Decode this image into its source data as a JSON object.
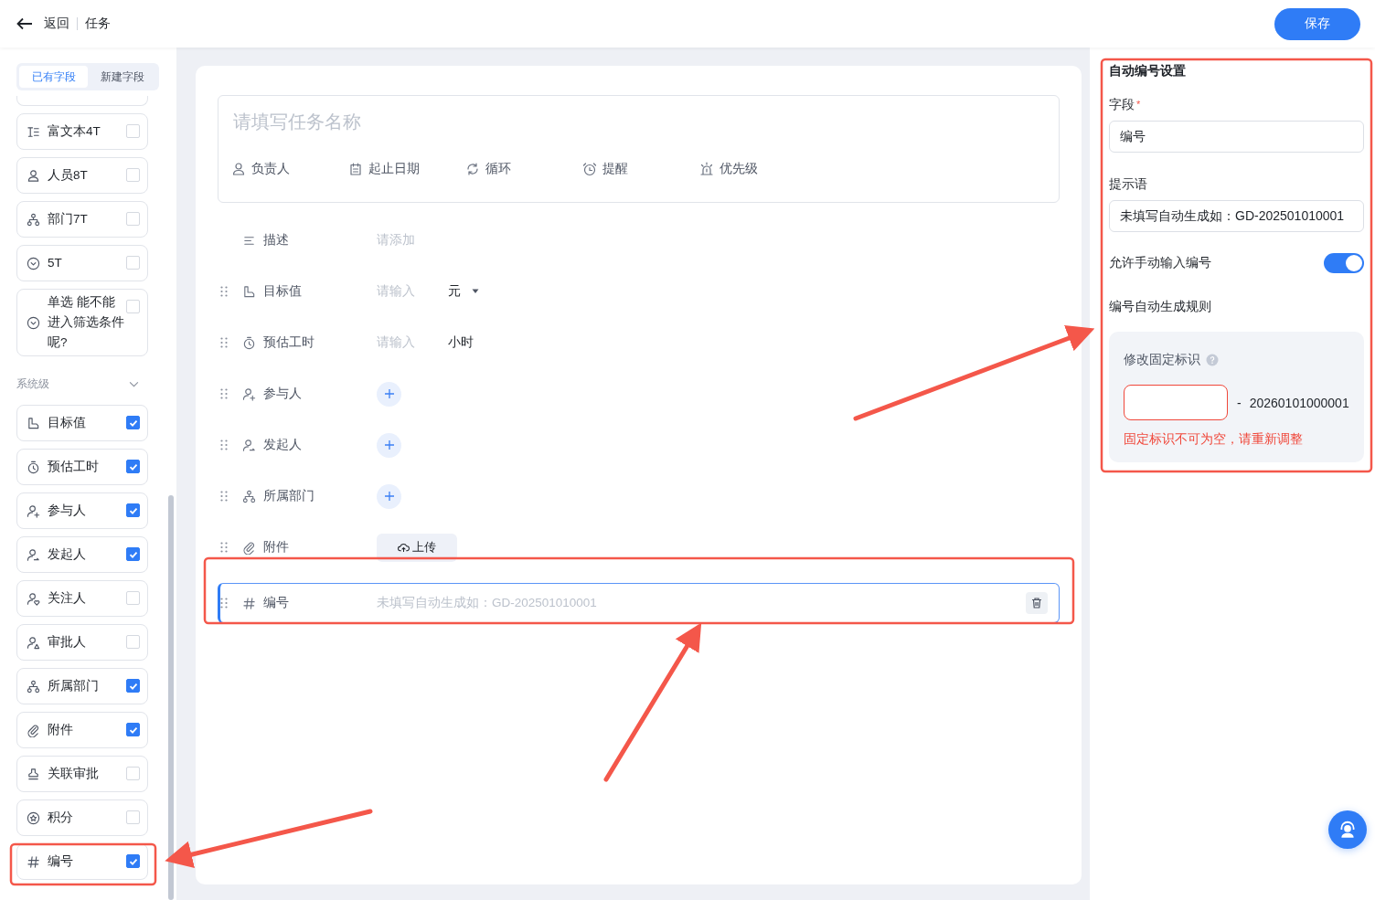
{
  "header": {
    "back_label": "返回",
    "title": "任务",
    "save_label": "保存"
  },
  "sidebar": {
    "tabs": [
      {
        "label": "已有字段",
        "selected": true
      },
      {
        "label": "新建字段",
        "selected": false
      }
    ],
    "custom_fields": [
      {
        "label": "富文本4T",
        "kind": "text",
        "checked": false
      },
      {
        "label": "人员8T",
        "kind": "person",
        "checked": false
      },
      {
        "label": "部门7T",
        "kind": "org",
        "checked": false
      },
      {
        "label": "5T",
        "kind": "select",
        "checked": false
      },
      {
        "label": "单选 能不能进入筛选条件呢?",
        "kind": "select",
        "checked": false
      }
    ],
    "group": {
      "label": "系统级",
      "expanded": true
    },
    "system_fields": [
      {
        "label": "目标值",
        "kind": "target",
        "checked": true
      },
      {
        "label": "预估工时",
        "kind": "timer",
        "checked": true
      },
      {
        "label": "参与人",
        "kind": "person-add",
        "checked": true
      },
      {
        "label": "发起人",
        "kind": "person-send",
        "checked": true
      },
      {
        "label": "关注人",
        "kind": "person-heart",
        "checked": false
      },
      {
        "label": "审批人",
        "kind": "person-stamp",
        "checked": false
      },
      {
        "label": "所属部门",
        "kind": "org",
        "checked": true
      },
      {
        "label": "附件",
        "kind": "clip",
        "checked": true
      },
      {
        "label": "关联审批",
        "kind": "stamp",
        "checked": false
      },
      {
        "label": "积分",
        "kind": "star",
        "checked": false
      },
      {
        "label": "编号",
        "kind": "hash",
        "checked": true
      }
    ]
  },
  "form": {
    "title_placeholder": "请填写任务名称",
    "quick_fields": [
      {
        "label": "负责人",
        "kind": "person"
      },
      {
        "label": "起止日期",
        "kind": "calendar"
      },
      {
        "label": "循环",
        "kind": "repeat"
      },
      {
        "label": "提醒",
        "kind": "alarm"
      },
      {
        "label": "优先级",
        "kind": "beacon"
      }
    ],
    "rows": [
      {
        "label": "描述",
        "kind": "description",
        "selected": false,
        "placeholder": "请添加"
      },
      {
        "label": "目标值",
        "kind": "target",
        "selected": false,
        "placeholder": "请输入",
        "unit": "元",
        "unit_dropdown": true
      },
      {
        "label": "预估工时",
        "kind": "timer",
        "selected": false,
        "placeholder": "请输入",
        "unit": "小时",
        "unit_dropdown": false
      },
      {
        "label": "参与人",
        "kind": "person-add",
        "selected": false
      },
      {
        "label": "发起人",
        "kind": "person-send",
        "selected": false
      },
      {
        "label": "所属部门",
        "kind": "org",
        "selected": false
      },
      {
        "label": "附件",
        "kind": "clip",
        "selected": false,
        "button_label": "上传"
      },
      {
        "label": "编号",
        "kind": "hash",
        "selected": true,
        "placeholder": "未填写自动生成如：GD-202501010001"
      }
    ]
  },
  "settings": {
    "title": "自动编号设置",
    "field": {
      "label": "字段",
      "required_mark": "*",
      "value": "编号"
    },
    "hint": {
      "label": "提示语",
      "value": "未填写自动生成如：GD-202501010001"
    },
    "manual_label": "允许手动输入编号",
    "manual_on": true,
    "rule_label": "编号自动生成规则",
    "rule": {
      "label": "修改固定标识",
      "prefix_error": true,
      "separator": "-",
      "sequence": "20260101000001",
      "error_message": "固定标识不可为空，请重新调整"
    }
  }
}
